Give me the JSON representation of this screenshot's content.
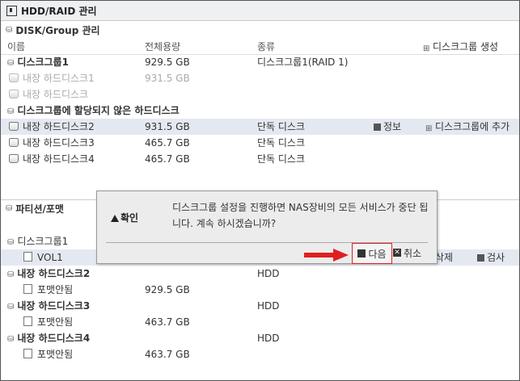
{
  "window": {
    "title": "HDD/RAID 관리"
  },
  "disk_group_section": {
    "title": "DISK/Group 관리",
    "columns": {
      "name": "이름",
      "capacity": "전체용량",
      "type": "종류"
    },
    "create_group_label": "디스크그룹 생성",
    "rows": [
      {
        "name": "디스크그룹1",
        "capacity": "929.5 GB",
        "type": "디스크그룹1(RAID 1)"
      },
      {
        "name": "내장 하드디스크1",
        "capacity": "931.5 GB",
        "type": ""
      },
      {
        "name": "내장 하드디스크",
        "capacity": "",
        "type": ""
      }
    ],
    "unassigned_title": "디스크그룹에 할당되지 않은 하드디스크",
    "unassigned_rows": [
      {
        "name": "내장 하드디스크2",
        "capacity": "931.5 GB",
        "type": "단독 디스크",
        "info_label": "정보",
        "add_label": "디스크그룹에 추가"
      },
      {
        "name": "내장 하드디스크3",
        "capacity": "465.7 GB",
        "type": "단독 디스크"
      },
      {
        "name": "내장 하드디스크4",
        "capacity": "465.7 GB",
        "type": "단독 디스크"
      }
    ]
  },
  "partition_section": {
    "title": "파티션/포맷",
    "rows": [
      {
        "name": "디스크그룹1",
        "capacity": "",
        "type": ""
      },
      {
        "name": "VOL1",
        "capacity": "",
        "type": "",
        "delete_label": "삭제",
        "check_label": "검사"
      },
      {
        "name": "내장 하드디스크2",
        "capacity": "",
        "type": "HDD"
      },
      {
        "name": "포맷안됨",
        "capacity": "929.5 GB",
        "type": ""
      },
      {
        "name": "내장 하드디스크3",
        "capacity": "",
        "type": "HDD"
      },
      {
        "name": "포맷안됨",
        "capacity": "463.7 GB",
        "type": ""
      },
      {
        "name": "내장 하드디스크4",
        "capacity": "",
        "type": "HDD"
      },
      {
        "name": "포맷안됨",
        "capacity": "463.7 GB",
        "type": ""
      }
    ]
  },
  "dialog": {
    "title": "확인",
    "message": "디스크그룹 설정을 진행하면 NAS장비의 모든 서비스가 중단 됩니다. 계속 하시겠습니까?",
    "next_label": "다음",
    "cancel_label": "취소"
  },
  "colors": {
    "highlight_border": "#e02020",
    "arrow": "#e02020",
    "selected_row": "#e4e9f1"
  }
}
